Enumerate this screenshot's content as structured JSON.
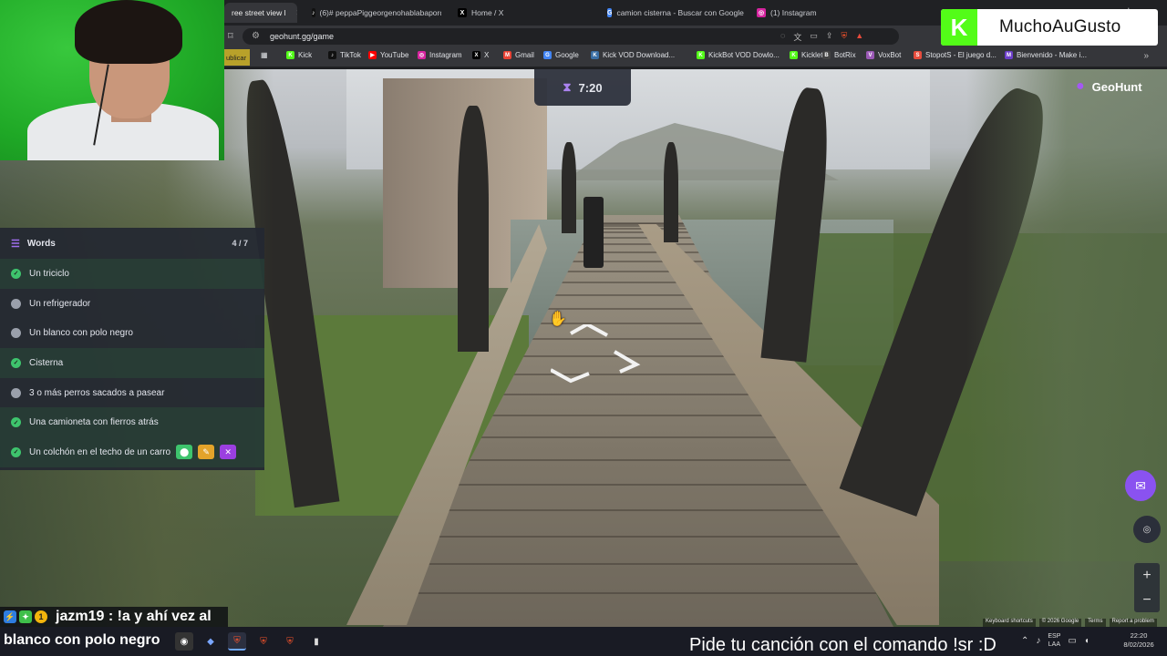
{
  "browser": {
    "tabs": [
      {
        "label": "ree street view l",
        "fav": "",
        "fav_color": "#34a853",
        "active": true
      },
      {
        "label": "(6)# peppaPiggeorgenohablabaporq",
        "fav": "♪",
        "fav_color": "#111111",
        "active": false
      },
      {
        "label": "Home / X",
        "fav": "X",
        "fav_color": "#000000",
        "active": false
      },
      {
        "label": "camion cisterna - Buscar con Google",
        "fav": "G",
        "fav_color": "#4285f4",
        "active": false
      },
      {
        "label": "(1) Instagram",
        "fav": "◎",
        "fav_color": "#d6249f",
        "active": false
      }
    ],
    "new_tab": "+",
    "url": "geohunt.gg/game",
    "bookmark_partial": "ublicar",
    "bookmarks": [
      {
        "label": "Kick",
        "color": "#53fc18",
        "glyph": "K"
      },
      {
        "label": "TikTok",
        "color": "#111111",
        "glyph": "♪"
      },
      {
        "label": "YouTube",
        "color": "#ff0000",
        "glyph": "▶"
      },
      {
        "label": "Instagram",
        "color": "#d6249f",
        "glyph": "◎"
      },
      {
        "label": "X",
        "color": "#000000",
        "glyph": "X"
      },
      {
        "label": "Gmail",
        "color": "#ea4335",
        "glyph": "M"
      },
      {
        "label": "Google",
        "color": "#4285f4",
        "glyph": "G"
      },
      {
        "label": "Kick VOD Download...",
        "color": "#3a6ea5",
        "glyph": "K"
      },
      {
        "label": "KickBot VOD Dowlo...",
        "color": "#53fc18",
        "glyph": "K"
      },
      {
        "label": "Kicklet",
        "color": "#53fc18",
        "glyph": "K"
      },
      {
        "label": "BotRix",
        "color": "#444444",
        "glyph": "B"
      },
      {
        "label": "VoxBot",
        "color": "#9b59b6",
        "glyph": "V"
      },
      {
        "label": "StopotS - El juego d...",
        "color": "#e74c3c",
        "glyph": "S"
      },
      {
        "label": "Bienvenido - Make i...",
        "color": "#6c3fc9",
        "glyph": "M"
      }
    ]
  },
  "overlay": {
    "kick_name": "MuchoAuGusto",
    "kick_logo": "K"
  },
  "game": {
    "timer": "7:20",
    "brand": "GeoHunt",
    "words_title": "Words",
    "words_count": "4 / 7",
    "words": [
      {
        "label": "Un triciclo",
        "done": true
      },
      {
        "label": "Un refrigerador",
        "done": false
      },
      {
        "label": "Un blanco con polo negro",
        "done": false
      },
      {
        "label": "Cisterna",
        "done": true
      },
      {
        "label": "3 o más perros sacados a pasear",
        "done": false
      },
      {
        "label": "Una camioneta con fierros atrás",
        "done": true
      },
      {
        "label": "Un colchón en el techo de un carro",
        "done": true
      }
    ],
    "footer": [
      "Keyboard shortcuts",
      "© 2026 Google",
      "Terms",
      "Report a problem"
    ],
    "zoom_in": "+",
    "zoom_out": "−"
  },
  "chat": {
    "user": "jazm19",
    "message_line1": "jazm19 : !a y ahí vez al",
    "message_line2": "blanco con polo negro"
  },
  "stream": {
    "ticker": "Pide tu canción con el comando !sr :D"
  },
  "taskbar": {
    "lang_top": "ESP",
    "lang_bottom": "LAA",
    "time": "22:20",
    "date": "8/02/2026"
  }
}
